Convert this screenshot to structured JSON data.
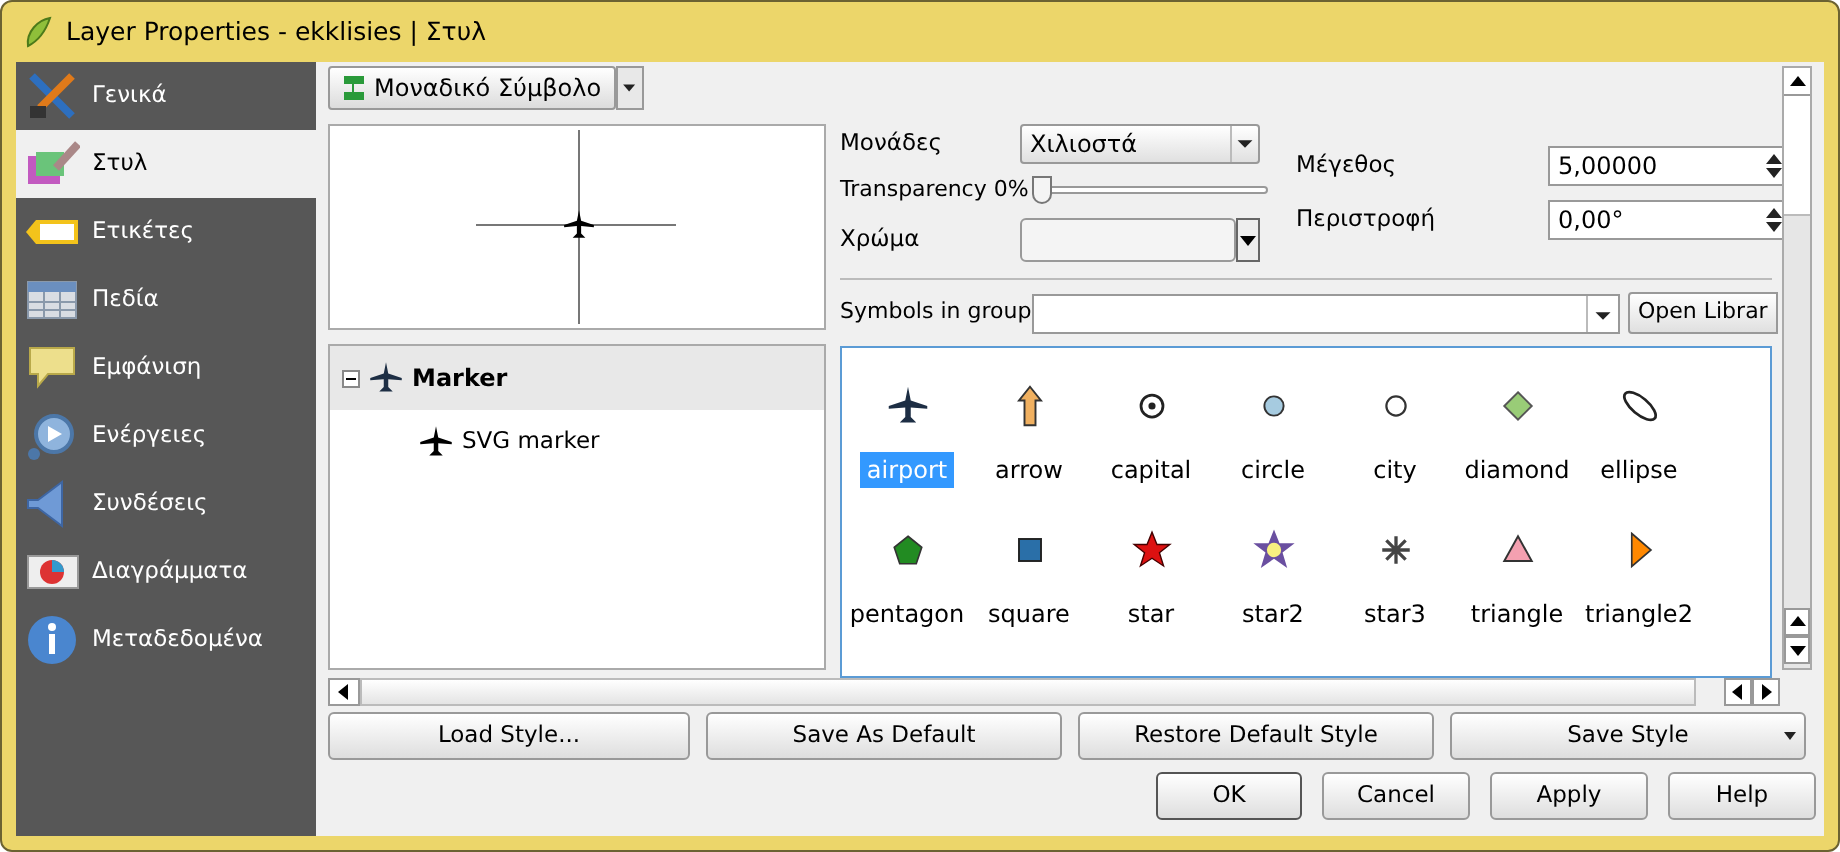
{
  "window": {
    "title": "Layer Properties - ekklisies | Στυλ"
  },
  "sidebar": {
    "items": [
      {
        "label": "Γενικά",
        "kind": "tools",
        "selected": false
      },
      {
        "label": "Στυλ",
        "kind": "style",
        "selected": true
      },
      {
        "label": "Ετικέτες",
        "kind": "labels",
        "selected": false
      },
      {
        "label": "Πεδία",
        "kind": "fields",
        "selected": false
      },
      {
        "label": "Εμφάνιση",
        "kind": "display",
        "selected": false
      },
      {
        "label": "Ενέργειες",
        "kind": "actions",
        "selected": false
      },
      {
        "label": "Συνδέσεις",
        "kind": "joins",
        "selected": false
      },
      {
        "label": "Διαγράμματα",
        "kind": "diagrams",
        "selected": false
      },
      {
        "label": "Μεταδεδομένα",
        "kind": "metadata",
        "selected": false
      }
    ]
  },
  "renderer": {
    "value": "Μοναδικό Σύμβολο"
  },
  "symbol_tree": {
    "items": [
      {
        "label": "Marker",
        "expanded": true,
        "selected": true,
        "children": [
          {
            "label": "SVG marker"
          }
        ]
      }
    ]
  },
  "properties": {
    "units": {
      "label": "Μονάδες",
      "value": "Χιλιοστά"
    },
    "transparency": {
      "label": "Transparency 0%",
      "level": 0
    },
    "color": {
      "label": "Χρώμα"
    },
    "size": {
      "label": "Μέγεθος",
      "value": "5,00000"
    },
    "rotation": {
      "label": "Περιστροφή",
      "value": "0,00°"
    }
  },
  "symbols_in_group": {
    "label": "Symbols in group",
    "button": "Open Librar"
  },
  "symbols": [
    {
      "name": "airport",
      "kind": "airport",
      "selected": true
    },
    {
      "name": "arrow",
      "kind": "arrow",
      "selected": false
    },
    {
      "name": "capital",
      "kind": "capital",
      "selected": false
    },
    {
      "name": "circle",
      "kind": "circle",
      "selected": false
    },
    {
      "name": "city",
      "kind": "city",
      "selected": false
    },
    {
      "name": "diamond",
      "kind": "diamond",
      "selected": false
    },
    {
      "name": "ellipse",
      "kind": "ellipse",
      "selected": false
    },
    {
      "name": "pentagon",
      "kind": "pentagon",
      "selected": false
    },
    {
      "name": "square",
      "kind": "square",
      "selected": false
    },
    {
      "name": "star",
      "kind": "star",
      "selected": false
    },
    {
      "name": "star2",
      "kind": "star2",
      "selected": false
    },
    {
      "name": "star3",
      "kind": "star3",
      "selected": false
    },
    {
      "name": "triangle",
      "kind": "triangle",
      "selected": false
    },
    {
      "name": "triangle2",
      "kind": "triangle2",
      "selected": false
    }
  ],
  "style_buttons": [
    "Load Style...",
    "Save As Default",
    "Restore Default Style",
    "Save Style"
  ],
  "dialog_buttons": [
    "OK",
    "Cancel",
    "Apply",
    "Help"
  ]
}
